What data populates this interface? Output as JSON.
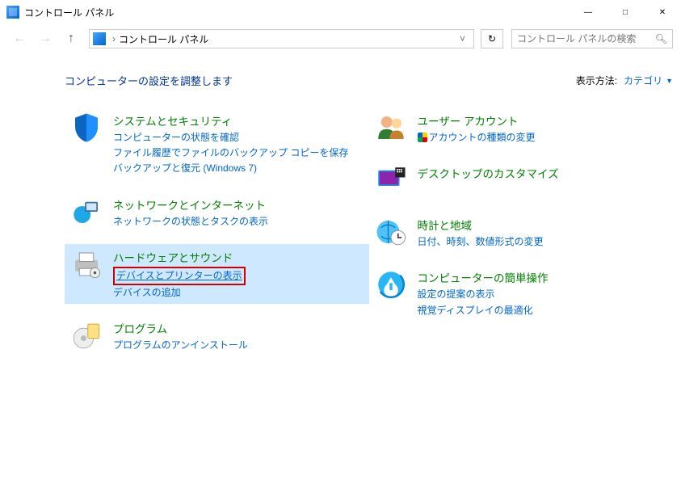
{
  "window": {
    "title": "コントロール パネル"
  },
  "nav": {
    "breadcrumb": "コントロール パネル",
    "search_placeholder": "コントロール パネルの検索"
  },
  "content": {
    "heading": "コンピューターの設定を調整します",
    "view_label": "表示方法:",
    "view_value": "カテゴリ"
  },
  "left": [
    {
      "title": "システムとセキュリティ",
      "subs": [
        "コンピューターの状態を確認",
        "ファイル履歴でファイルのバックアップ コピーを保存",
        "バックアップと復元 (Windows 7)"
      ]
    },
    {
      "title": "ネットワークとインターネット",
      "subs": [
        "ネットワークの状態とタスクの表示"
      ]
    },
    {
      "title": "ハードウェアとサウンド",
      "subs": [
        "デバイスとプリンターの表示",
        "デバイスの追加"
      ],
      "highlight": 0
    },
    {
      "title": "プログラム",
      "subs": [
        "プログラムのアンインストール"
      ]
    }
  ],
  "right": [
    {
      "title": "ユーザー アカウント",
      "subs": [
        "アカウントの種類の変更"
      ],
      "shield": [
        0
      ]
    },
    {
      "title": "デスクトップのカスタマイズ",
      "subs": []
    },
    {
      "title": "時計と地域",
      "subs": [
        "日付、時刻、数値形式の変更"
      ]
    },
    {
      "title": "コンピューターの簡単操作",
      "subs": [
        "設定の提案の表示",
        "視覚ディスプレイの最適化"
      ]
    }
  ]
}
